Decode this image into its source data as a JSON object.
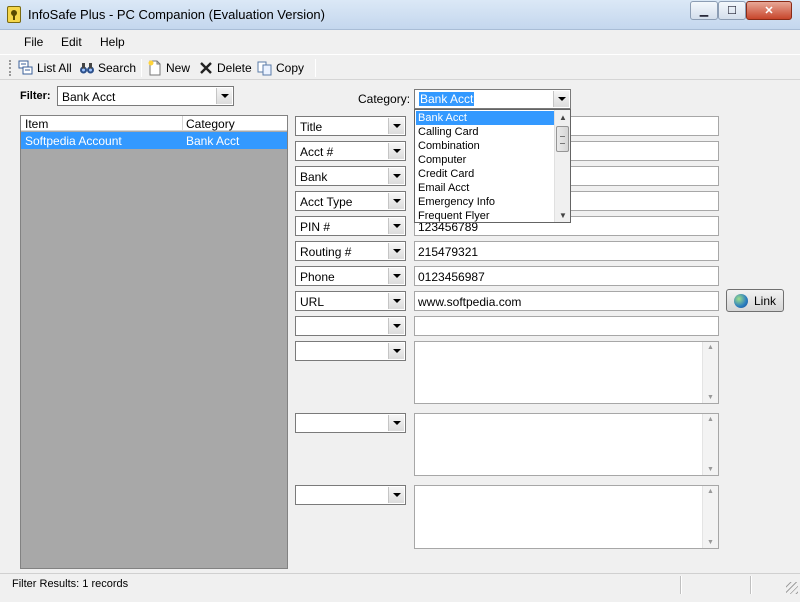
{
  "window": {
    "title": "InfoSafe Plus - PC Companion (Evaluation Version)"
  },
  "menu": [
    "File",
    "Edit",
    "Help"
  ],
  "toolbar": {
    "list_all": "List All",
    "search": "Search",
    "new": "New",
    "delete": "Delete",
    "copy": "Copy"
  },
  "filter": {
    "label": "Filter:",
    "value": "Bank Acct"
  },
  "list": {
    "columns": [
      "Item",
      "Category"
    ],
    "rows": [
      {
        "item": "Softpedia Account",
        "category": "Bank Acct"
      }
    ]
  },
  "category": {
    "label": "Category:",
    "value": "Bank Acct"
  },
  "fields": [
    {
      "label": "Title",
      "value": ""
    },
    {
      "label": "Acct #",
      "value": ""
    },
    {
      "label": "Bank",
      "value": ""
    },
    {
      "label": "Acct Type",
      "value": ""
    },
    {
      "label": "PIN #",
      "value": "123456789"
    },
    {
      "label": "Routing #",
      "value": "215479321"
    },
    {
      "label": "Phone",
      "value": "0123456987"
    },
    {
      "label": "URL",
      "value": "www.softpedia.com"
    },
    {
      "label": "",
      "value": ""
    }
  ],
  "memos": [
    {
      "label": ""
    },
    {
      "label": ""
    },
    {
      "label": ""
    }
  ],
  "link_button": "Link",
  "dropdown_options": [
    "Bank Acct",
    "Calling Card",
    "Combination",
    "Computer",
    "Credit Card",
    "Email Acct",
    "Emergency Info",
    "Frequent Flyer"
  ],
  "status": {
    "text": "Filter Results: 1 records"
  }
}
